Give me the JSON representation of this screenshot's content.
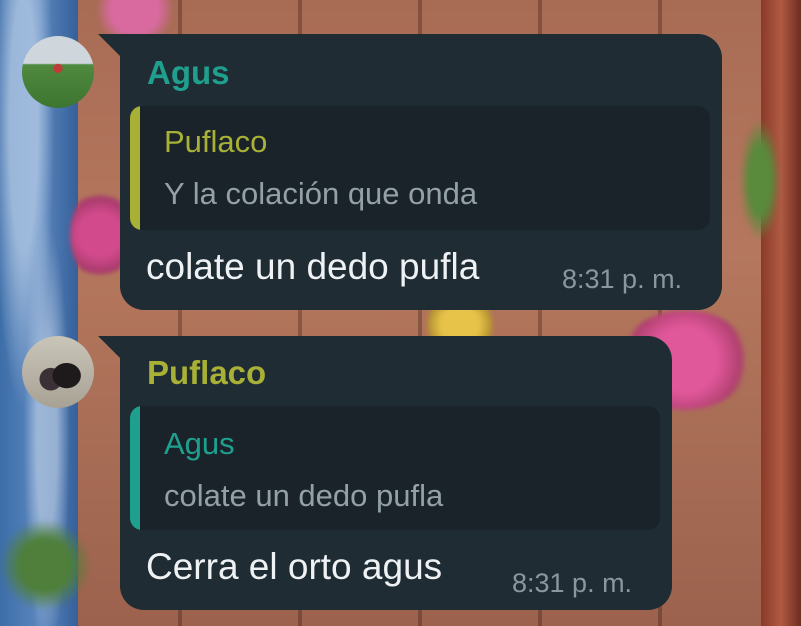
{
  "colors": {
    "bubble_bg": "#202c33",
    "quote_bg": "#1a2329",
    "agus_name": "#1fa08f",
    "puflaco_name": "#a8b035",
    "message_text": "#eef2f4",
    "quote_text": "#93a0a8",
    "timestamp": "#8a979f"
  },
  "messages": [
    {
      "sender": "Agus",
      "avatar_icon": "soccer-player-avatar",
      "quoted": {
        "name": "Puflaco",
        "text": "Y la colación que onda"
      },
      "text": "colate un dedo pufla",
      "time": "8:31 p. m."
    },
    {
      "sender": "Puflaco",
      "avatar_icon": "couple-photo-avatar",
      "quoted": {
        "name": "Agus",
        "text": "colate un dedo pufla"
      },
      "text": "Cerra el orto agus",
      "time": "8:31 p. m."
    }
  ]
}
